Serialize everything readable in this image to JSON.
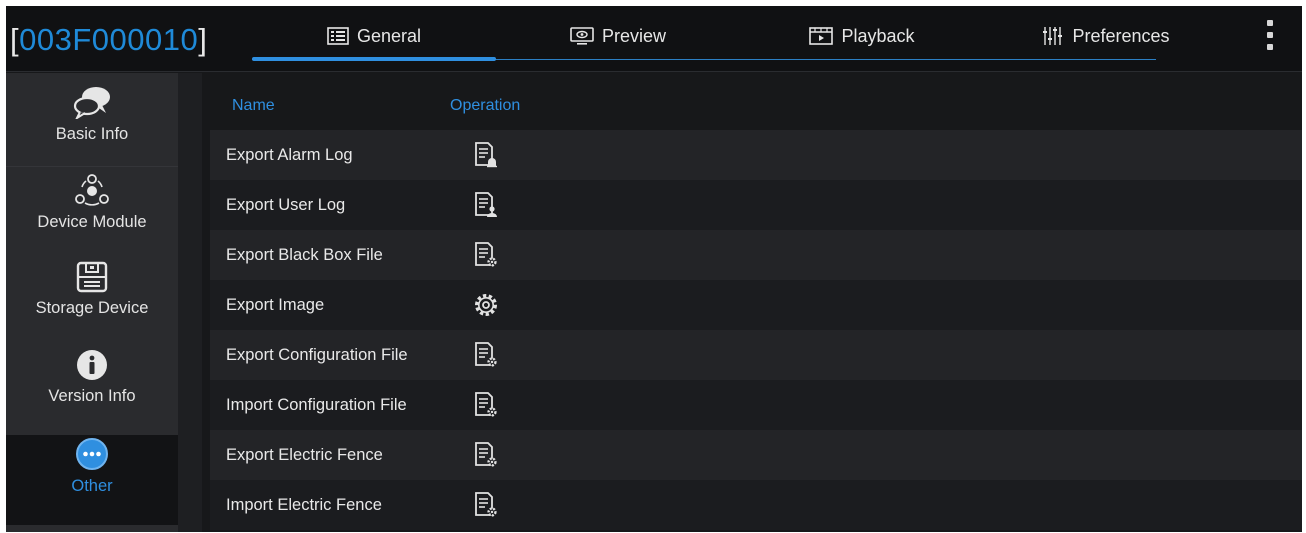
{
  "header": {
    "bracket_open": "[",
    "device_id": "003F000010",
    "bracket_close": "]",
    "tabs": [
      {
        "label": "General",
        "icon": "list-panel-icon"
      },
      {
        "label": "Preview",
        "icon": "monitor-icon"
      },
      {
        "label": "Playback",
        "icon": "film-icon"
      },
      {
        "label": "Preferences",
        "icon": "sliders-icon"
      }
    ],
    "active_tab": "General",
    "more_icon": "vertical-ellipsis-icon"
  },
  "sidebar": {
    "items": [
      {
        "label": "Basic Info",
        "icon": "chat-bubbles-icon"
      },
      {
        "label": "Device Module",
        "icon": "module-cluster-icon"
      },
      {
        "label": "Storage Device",
        "icon": "floppy-disk-icon"
      },
      {
        "label": "Version Info",
        "icon": "info-circle-icon"
      },
      {
        "label": "Other",
        "icon": "more-circle-icon"
      }
    ],
    "active_item": "Other"
  },
  "table": {
    "headers": {
      "name": "Name",
      "operation": "Operation"
    },
    "rows": [
      {
        "name": "Export Alarm Log",
        "icon": "document-alarm-icon"
      },
      {
        "name": "Export User Log",
        "icon": "document-user-icon"
      },
      {
        "name": "Export Black Box File",
        "icon": "document-gear-icon"
      },
      {
        "name": "Export Image",
        "icon": "gear-icon"
      },
      {
        "name": "Export Configuration File",
        "icon": "document-gear-icon"
      },
      {
        "name": "Import Configuration File",
        "icon": "document-gear-icon"
      },
      {
        "name": "Export Electric Fence",
        "icon": "document-gear-icon"
      },
      {
        "name": "Import Electric Fence",
        "icon": "document-gear-icon"
      }
    ]
  },
  "colors": {
    "accent": "#2f8fe0",
    "device_id": "#1f8ad8",
    "background": "#17181a",
    "sidebar": "#2a2b2e"
  }
}
